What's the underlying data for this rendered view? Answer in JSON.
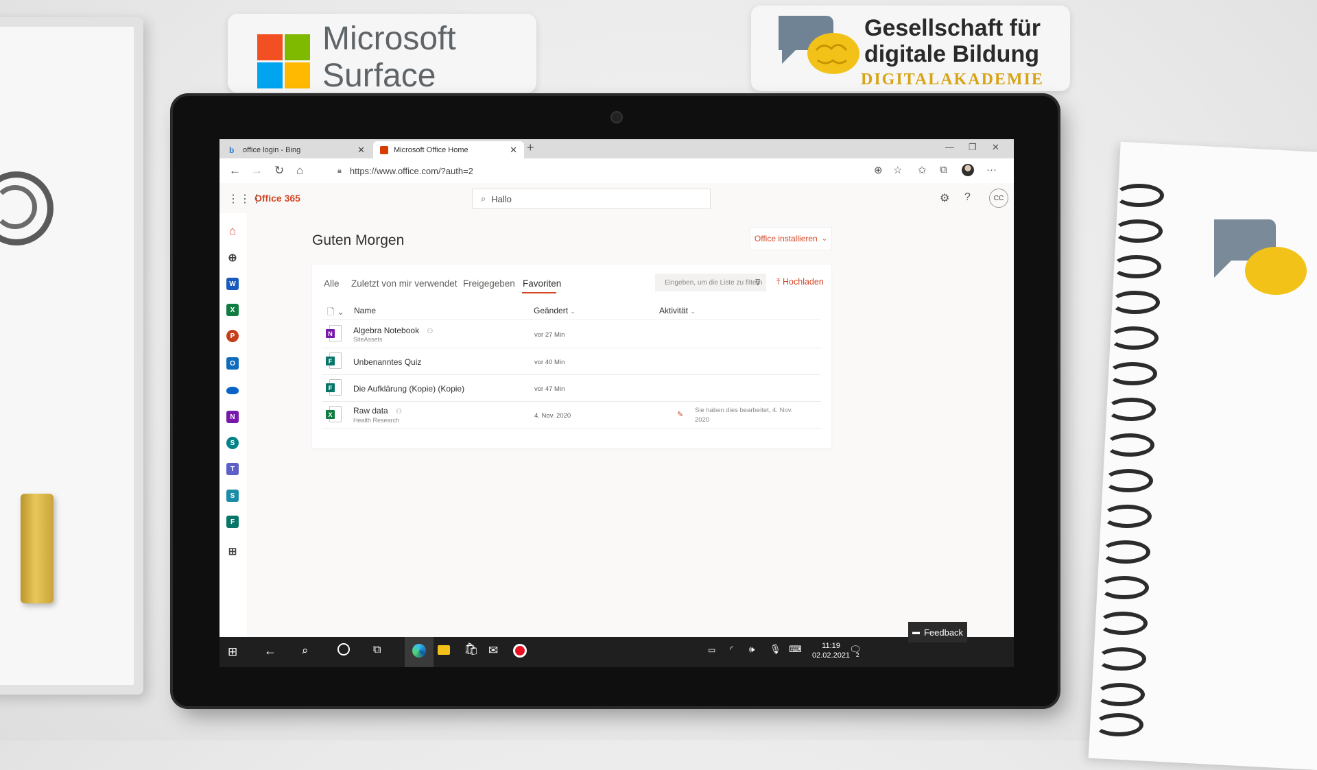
{
  "background": {
    "ms_sticker": {
      "line1": "Microsoft",
      "line2": "Surface"
    },
    "gdb_sticker": {
      "line1": "Gesellschaft für",
      "line2": "digitale Bildung",
      "line3": "DIGITALAKADEMIE"
    }
  },
  "browser": {
    "tabs": [
      {
        "title": "office login - Bing"
      },
      {
        "title": "Microsoft Office Home"
      }
    ],
    "url": "https://www.office.com/?auth=2"
  },
  "office": {
    "brand": "Office 365",
    "search_value": "Hallo",
    "avatar_initials": "CC",
    "greeting": "Guten Morgen",
    "install_label": "Office installieren",
    "filter_tabs": [
      "Alle",
      "Zuletzt von mir verwendet",
      "Freigegeben",
      "Favoriten"
    ],
    "filter_placeholder": "Eingeben, um die Liste zu filtern",
    "upload_label": "Hochladen",
    "columns": {
      "name": "Name",
      "changed": "Geändert",
      "activity": "Aktivität"
    },
    "files": [
      {
        "name": "Algebra Notebook",
        "sub": "SiteAssets",
        "date": "vor 27 Min",
        "activity": "",
        "app": "N"
      },
      {
        "name": "Unbenanntes Quiz",
        "sub": "",
        "date": "vor 40 Min",
        "activity": "",
        "app": "F"
      },
      {
        "name": "Die Aufklärung (Kopie) (Kopie)",
        "sub": "",
        "date": "vor 47 Min",
        "activity": "",
        "app": "F"
      },
      {
        "name": "Raw data",
        "sub": "Health Research",
        "date": "4. Nov. 2020",
        "activity": "Sie haben dies bearbeitet, 4. Nov. 2020",
        "app": "X"
      }
    ],
    "feedback_label": "Feedback"
  },
  "taskbar": {
    "time": "11:19",
    "date": "02.02.2021",
    "notifications": "2"
  },
  "colors": {
    "office_accent": "#d24726",
    "word": "#185abd",
    "excel": "#107c41",
    "powerpoint": "#c43e1c",
    "onenote": "#7719aa",
    "forms": "#077568"
  }
}
